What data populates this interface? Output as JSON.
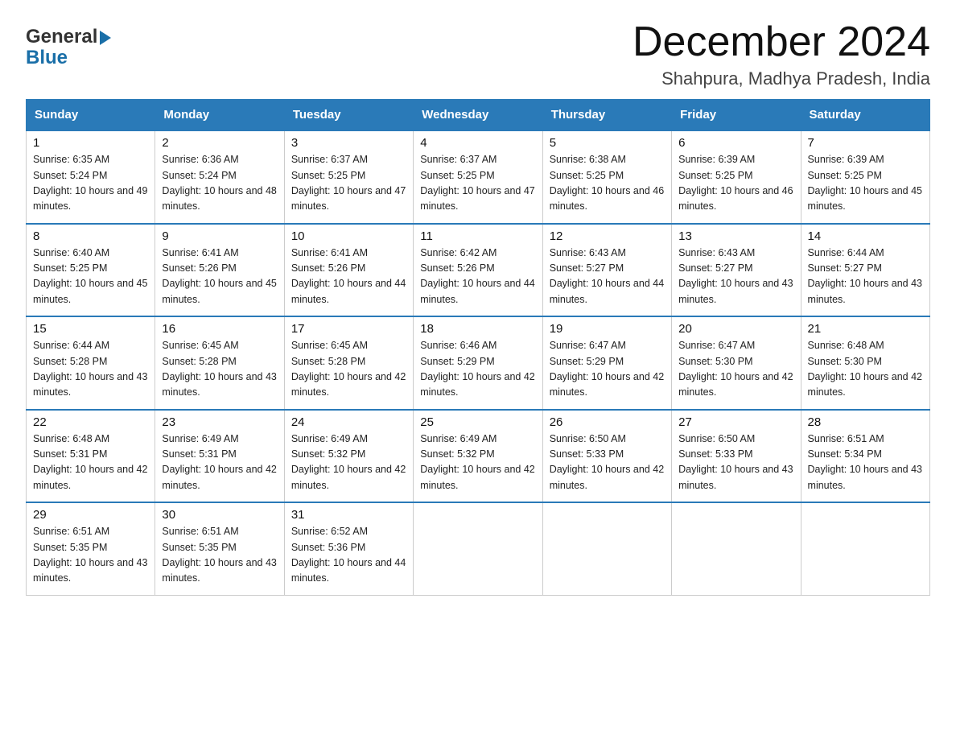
{
  "logo": {
    "general": "General",
    "blue": "Blue",
    "arrow": "▶"
  },
  "title": {
    "month": "December 2024",
    "location": "Shahpura, Madhya Pradesh, India"
  },
  "weekdays": [
    "Sunday",
    "Monday",
    "Tuesday",
    "Wednesday",
    "Thursday",
    "Friday",
    "Saturday"
  ],
  "weeks": [
    [
      {
        "day": "1",
        "sunrise": "6:35 AM",
        "sunset": "5:24 PM",
        "daylight": "10 hours and 49 minutes."
      },
      {
        "day": "2",
        "sunrise": "6:36 AM",
        "sunset": "5:24 PM",
        "daylight": "10 hours and 48 minutes."
      },
      {
        "day": "3",
        "sunrise": "6:37 AM",
        "sunset": "5:25 PM",
        "daylight": "10 hours and 47 minutes."
      },
      {
        "day": "4",
        "sunrise": "6:37 AM",
        "sunset": "5:25 PM",
        "daylight": "10 hours and 47 minutes."
      },
      {
        "day": "5",
        "sunrise": "6:38 AM",
        "sunset": "5:25 PM",
        "daylight": "10 hours and 46 minutes."
      },
      {
        "day": "6",
        "sunrise": "6:39 AM",
        "sunset": "5:25 PM",
        "daylight": "10 hours and 46 minutes."
      },
      {
        "day": "7",
        "sunrise": "6:39 AM",
        "sunset": "5:25 PM",
        "daylight": "10 hours and 45 minutes."
      }
    ],
    [
      {
        "day": "8",
        "sunrise": "6:40 AM",
        "sunset": "5:25 PM",
        "daylight": "10 hours and 45 minutes."
      },
      {
        "day": "9",
        "sunrise": "6:41 AM",
        "sunset": "5:26 PM",
        "daylight": "10 hours and 45 minutes."
      },
      {
        "day": "10",
        "sunrise": "6:41 AM",
        "sunset": "5:26 PM",
        "daylight": "10 hours and 44 minutes."
      },
      {
        "day": "11",
        "sunrise": "6:42 AM",
        "sunset": "5:26 PM",
        "daylight": "10 hours and 44 minutes."
      },
      {
        "day": "12",
        "sunrise": "6:43 AM",
        "sunset": "5:27 PM",
        "daylight": "10 hours and 44 minutes."
      },
      {
        "day": "13",
        "sunrise": "6:43 AM",
        "sunset": "5:27 PM",
        "daylight": "10 hours and 43 minutes."
      },
      {
        "day": "14",
        "sunrise": "6:44 AM",
        "sunset": "5:27 PM",
        "daylight": "10 hours and 43 minutes."
      }
    ],
    [
      {
        "day": "15",
        "sunrise": "6:44 AM",
        "sunset": "5:28 PM",
        "daylight": "10 hours and 43 minutes."
      },
      {
        "day": "16",
        "sunrise": "6:45 AM",
        "sunset": "5:28 PM",
        "daylight": "10 hours and 43 minutes."
      },
      {
        "day": "17",
        "sunrise": "6:45 AM",
        "sunset": "5:28 PM",
        "daylight": "10 hours and 42 minutes."
      },
      {
        "day": "18",
        "sunrise": "6:46 AM",
        "sunset": "5:29 PM",
        "daylight": "10 hours and 42 minutes."
      },
      {
        "day": "19",
        "sunrise": "6:47 AM",
        "sunset": "5:29 PM",
        "daylight": "10 hours and 42 minutes."
      },
      {
        "day": "20",
        "sunrise": "6:47 AM",
        "sunset": "5:30 PM",
        "daylight": "10 hours and 42 minutes."
      },
      {
        "day": "21",
        "sunrise": "6:48 AM",
        "sunset": "5:30 PM",
        "daylight": "10 hours and 42 minutes."
      }
    ],
    [
      {
        "day": "22",
        "sunrise": "6:48 AM",
        "sunset": "5:31 PM",
        "daylight": "10 hours and 42 minutes."
      },
      {
        "day": "23",
        "sunrise": "6:49 AM",
        "sunset": "5:31 PM",
        "daylight": "10 hours and 42 minutes."
      },
      {
        "day": "24",
        "sunrise": "6:49 AM",
        "sunset": "5:32 PM",
        "daylight": "10 hours and 42 minutes."
      },
      {
        "day": "25",
        "sunrise": "6:49 AM",
        "sunset": "5:32 PM",
        "daylight": "10 hours and 42 minutes."
      },
      {
        "day": "26",
        "sunrise": "6:50 AM",
        "sunset": "5:33 PM",
        "daylight": "10 hours and 42 minutes."
      },
      {
        "day": "27",
        "sunrise": "6:50 AM",
        "sunset": "5:33 PM",
        "daylight": "10 hours and 43 minutes."
      },
      {
        "day": "28",
        "sunrise": "6:51 AM",
        "sunset": "5:34 PM",
        "daylight": "10 hours and 43 minutes."
      }
    ],
    [
      {
        "day": "29",
        "sunrise": "6:51 AM",
        "sunset": "5:35 PM",
        "daylight": "10 hours and 43 minutes."
      },
      {
        "day": "30",
        "sunrise": "6:51 AM",
        "sunset": "5:35 PM",
        "daylight": "10 hours and 43 minutes."
      },
      {
        "day": "31",
        "sunrise": "6:52 AM",
        "sunset": "5:36 PM",
        "daylight": "10 hours and 44 minutes."
      },
      null,
      null,
      null,
      null
    ]
  ],
  "labels": {
    "sunrise": "Sunrise:",
    "sunset": "Sunset:",
    "daylight": "Daylight:"
  }
}
